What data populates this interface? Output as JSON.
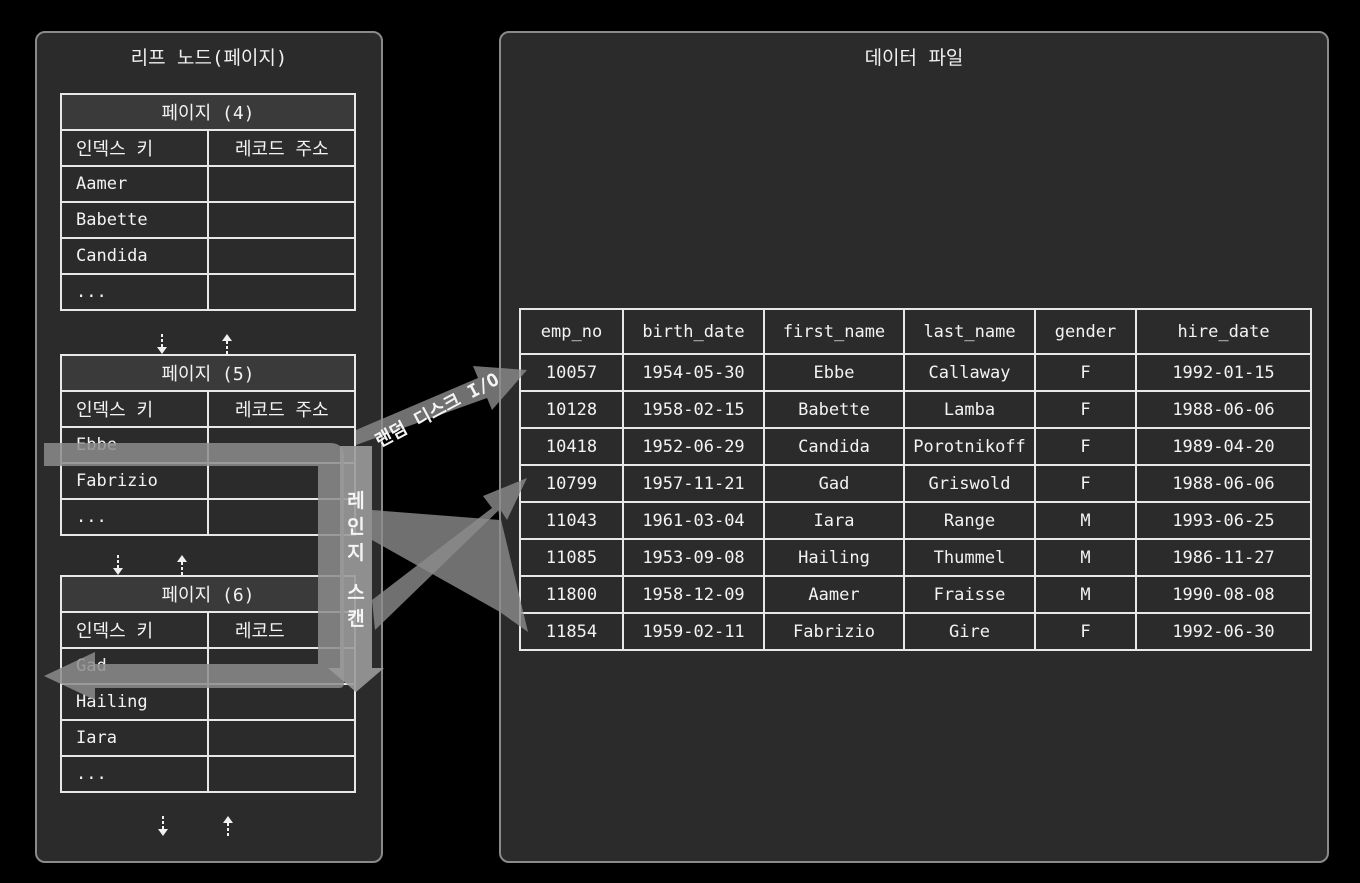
{
  "leaf_panel": {
    "title": "리프 노드(페이지)"
  },
  "data_panel": {
    "title": "데이터 파일"
  },
  "pages": [
    {
      "title": "페이지 (4)",
      "headers": [
        "인덱스 키",
        "레코드 주소"
      ],
      "rows": [
        "Aamer",
        "Babette",
        "Candida",
        "..."
      ]
    },
    {
      "title": "페이지 (5)",
      "headers": [
        "인덱스 키",
        "레코드 주소"
      ],
      "rows": [
        "Ebbe",
        "Fabrizio",
        "..."
      ]
    },
    {
      "title": "페이지 (6)",
      "headers": [
        "인덱스 키",
        "레코드"
      ],
      "rows": [
        "Gad",
        "Hailing",
        "Iara",
        "..."
      ]
    }
  ],
  "data_table": {
    "columns": [
      "emp_no",
      "birth_date",
      "first_name",
      "last_name",
      "gender",
      "hire_date"
    ],
    "rows": [
      [
        "10057",
        "1954-05-30",
        "Ebbe",
        "Callaway",
        "F",
        "1992-01-15"
      ],
      [
        "10128",
        "1958-02-15",
        "Babette",
        "Lamba",
        "F",
        "1988-06-06"
      ],
      [
        "10418",
        "1952-06-29",
        "Candida",
        "Porotnikoff",
        "F",
        "1989-04-20"
      ],
      [
        "10799",
        "1957-11-21",
        "Gad",
        "Griswold",
        "F",
        "1988-06-06"
      ],
      [
        "11043",
        "1961-03-04",
        "Iara",
        "Range",
        "M",
        "1993-06-25"
      ],
      [
        "11085",
        "1953-09-08",
        "Hailing",
        "Thummel",
        "M",
        "1986-11-27"
      ],
      [
        "11800",
        "1958-12-09",
        "Aamer",
        "Fraisse",
        "M",
        "1990-08-08"
      ],
      [
        "11854",
        "1959-02-11",
        "Fabrizio",
        "Gire",
        "F",
        "1992-06-30"
      ]
    ]
  },
  "labels": {
    "random_io": "랜덤 디스크 I/O",
    "range_scan": [
      "레",
      "인",
      "지",
      "",
      "스",
      "캔"
    ]
  },
  "colors": {
    "background": "#000000",
    "panel": "#2b2b2b",
    "border": "#e8e8e8",
    "arrow": "#8c8c8c"
  }
}
